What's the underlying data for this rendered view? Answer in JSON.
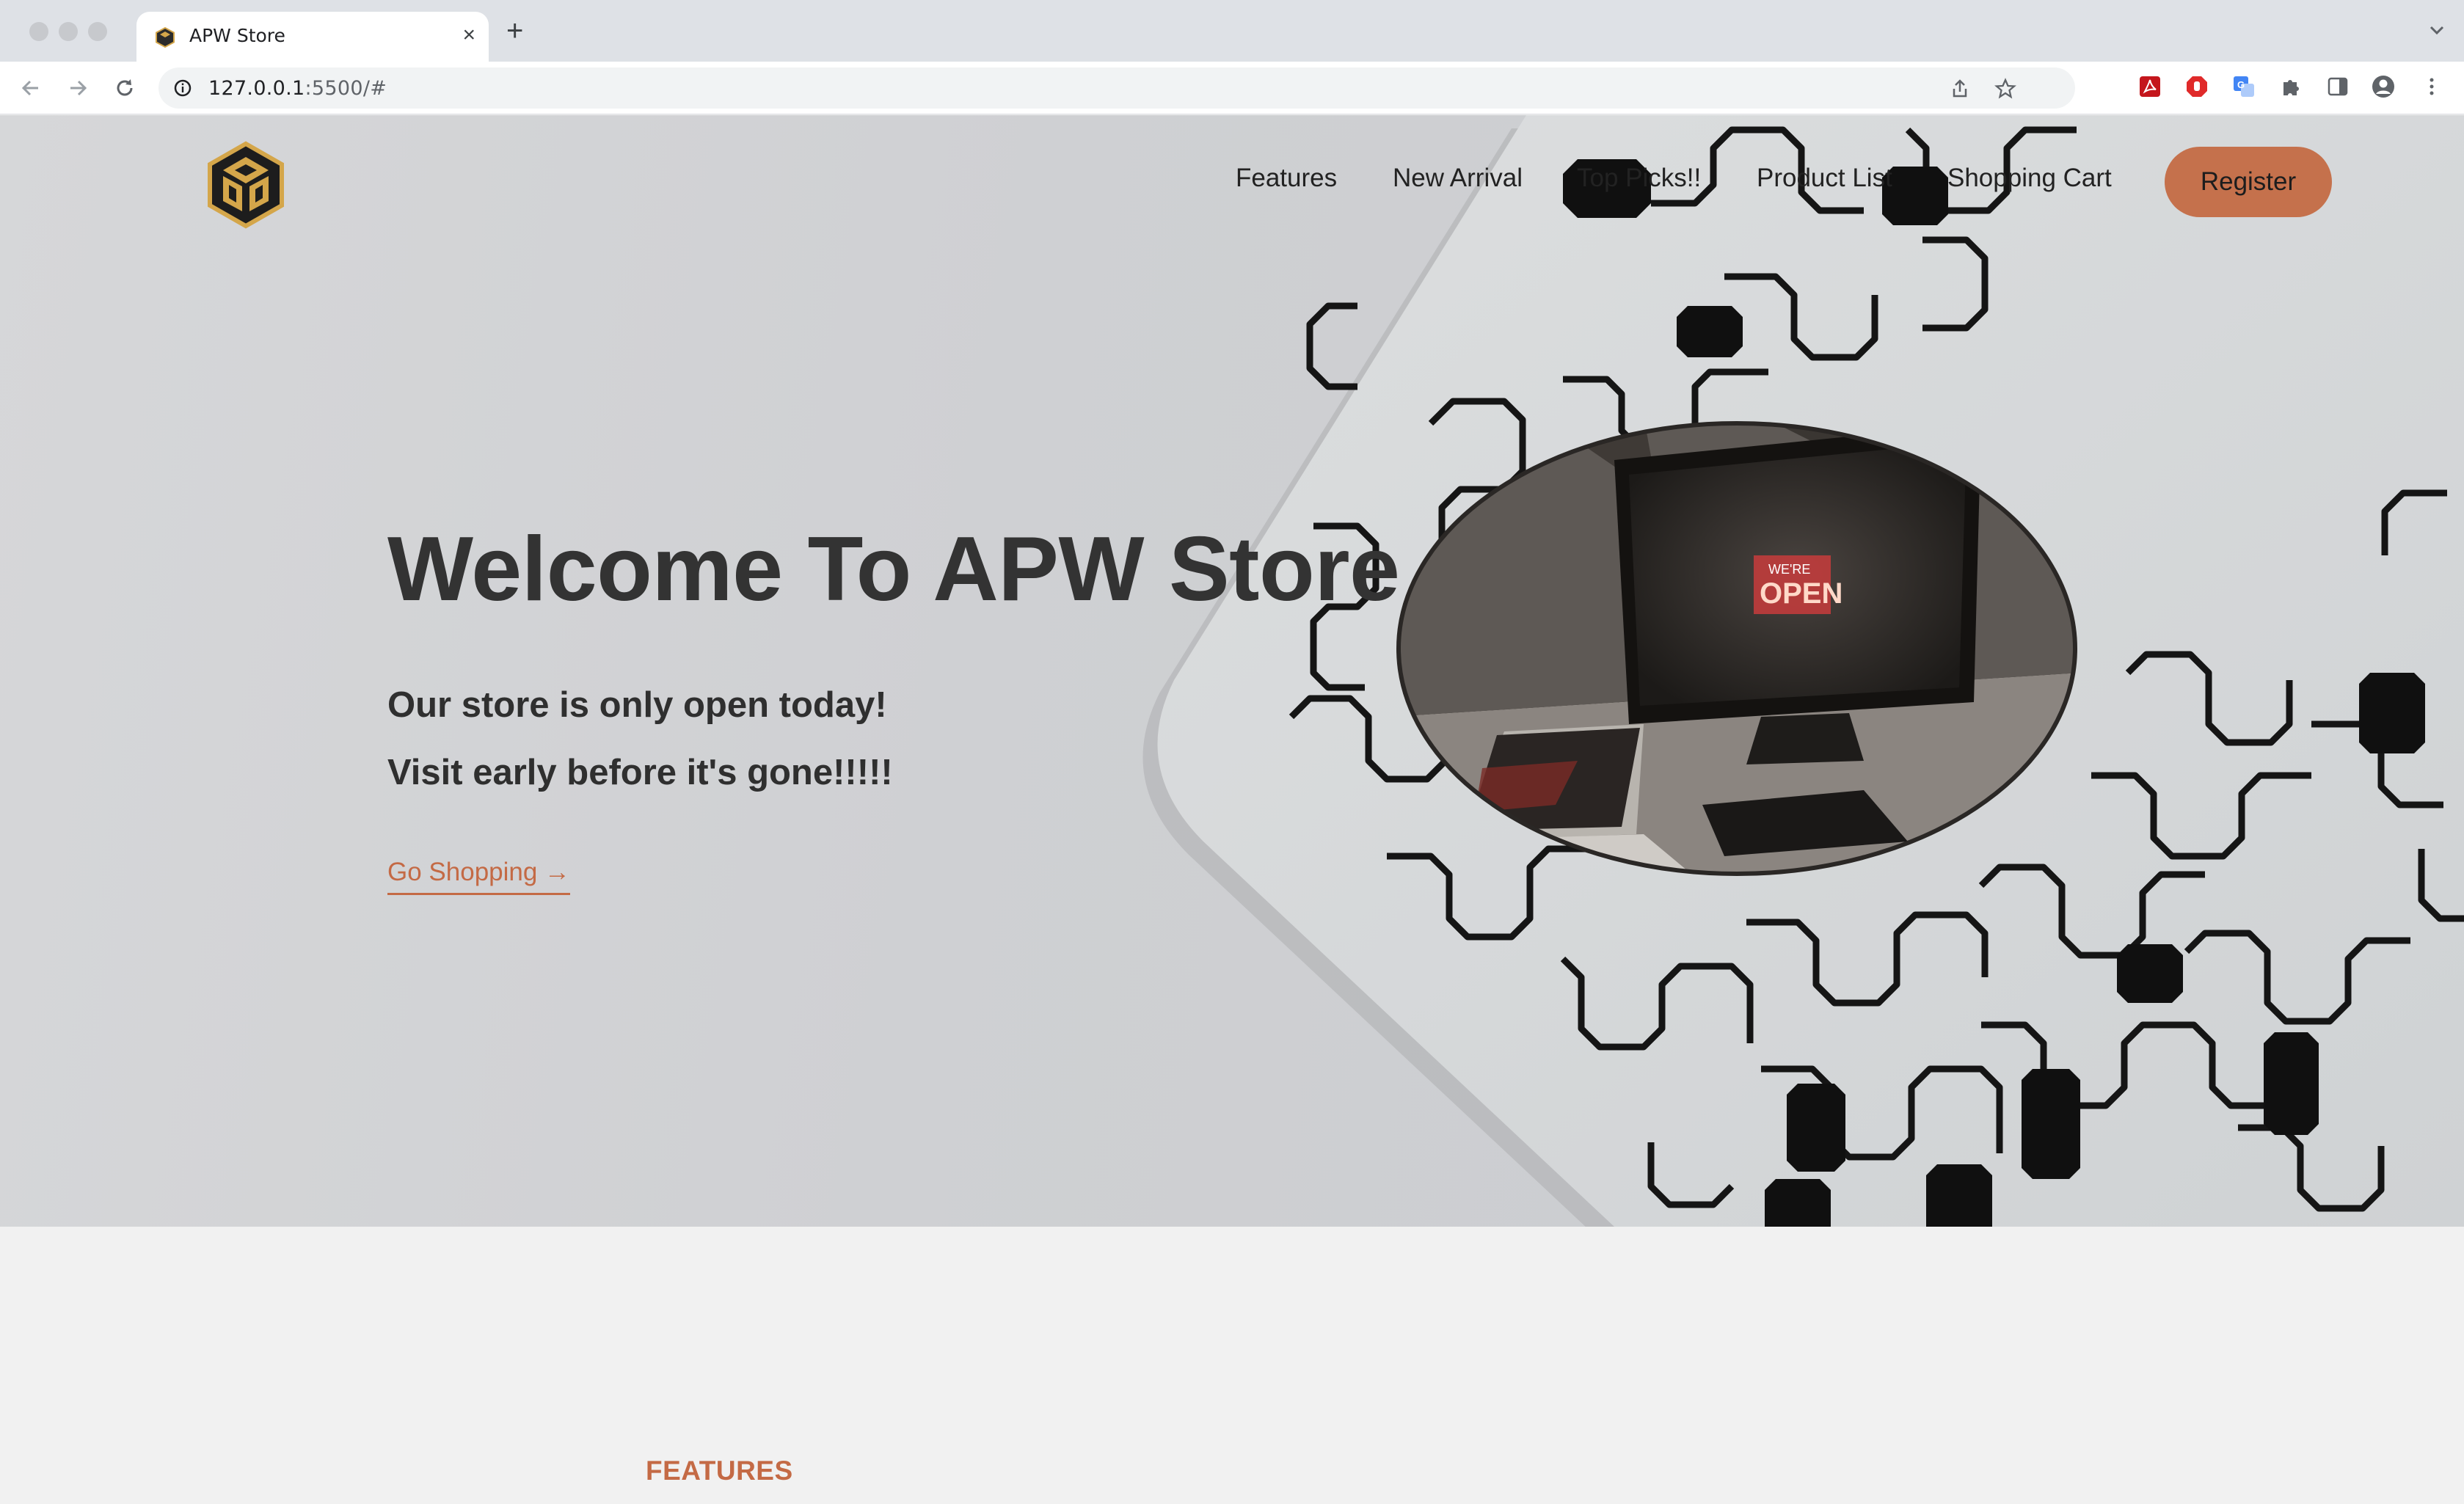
{
  "browser": {
    "tab_title": "APW Store",
    "url_host": "127.0.0.1",
    "url_rest": ":5500/#"
  },
  "site": {
    "nav": [
      {
        "label": "Features"
      },
      {
        "label": "New Arrival"
      },
      {
        "label": "Top Picks!!"
      },
      {
        "label": "Product List"
      },
      {
        "label": "Shopping Cart"
      }
    ],
    "register_label": "Register"
  },
  "hero": {
    "title": "Welcome To APW Store",
    "line1": "Our store is only open today!",
    "line2": "Visit early before it's gone!!!!!",
    "cta_label": "Go Shopping →",
    "sign_text": "OPEN",
    "sign_top": "WE'RE"
  },
  "features": {
    "label": "FEATURES"
  },
  "colors": {
    "accent": "#c46a45",
    "register_bg": "#c5714c",
    "hero_text": "#333333"
  }
}
